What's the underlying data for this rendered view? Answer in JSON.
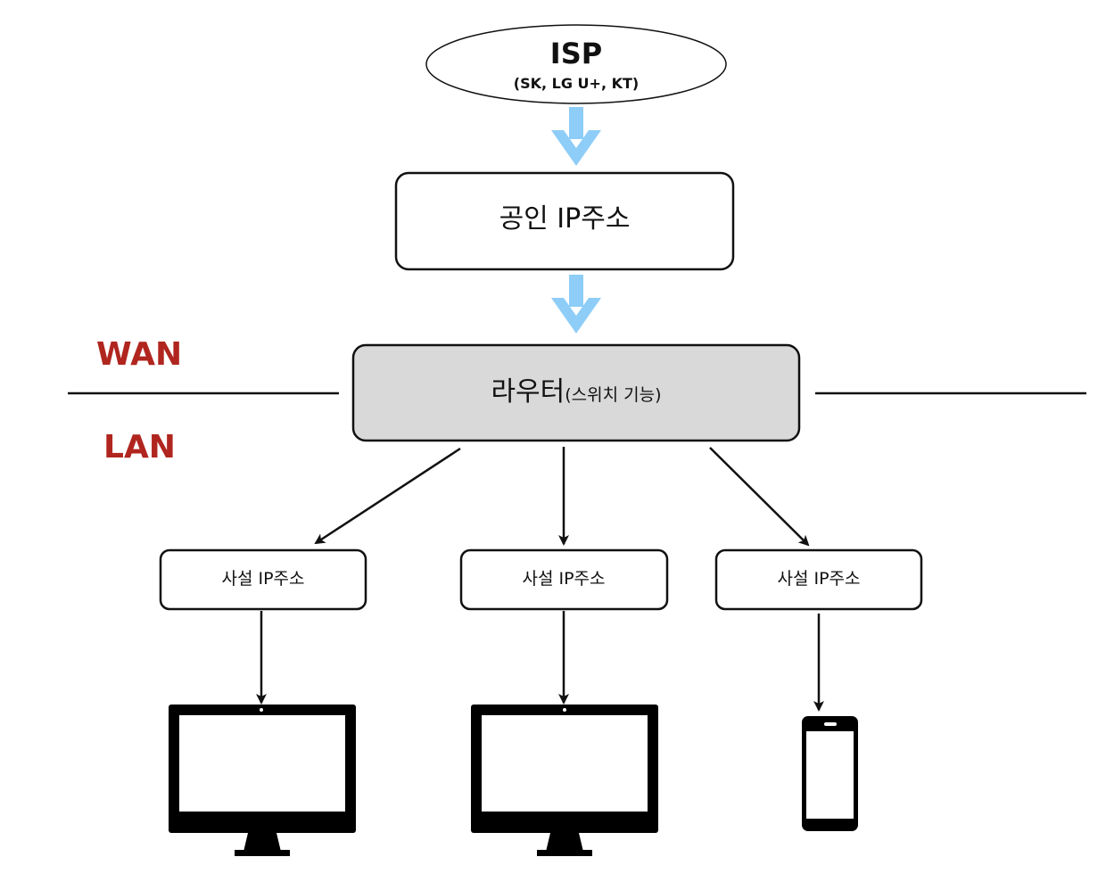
{
  "isp": {
    "title": "ISP",
    "subtitle": "(SK, LG U+, KT)"
  },
  "public_ip": {
    "label": "공인 IP주소"
  },
  "router": {
    "label": "라우터",
    "sublabel": "(스위치 기능)"
  },
  "zones": {
    "wan": "WAN",
    "lan": "LAN"
  },
  "private_ips": [
    {
      "label": "사설 IP주소"
    },
    {
      "label": "사설 IP주소"
    },
    {
      "label": "사설 IP주소"
    }
  ],
  "devices": [
    {
      "icon": "monitor-icon"
    },
    {
      "icon": "monitor-icon"
    },
    {
      "icon": "smartphone-icon"
    }
  ],
  "colors": {
    "zone_label": "#b0261f",
    "isp_arrow": "#8ecdf7",
    "router_fill": "#d9d9d9",
    "stroke": "#111111"
  }
}
